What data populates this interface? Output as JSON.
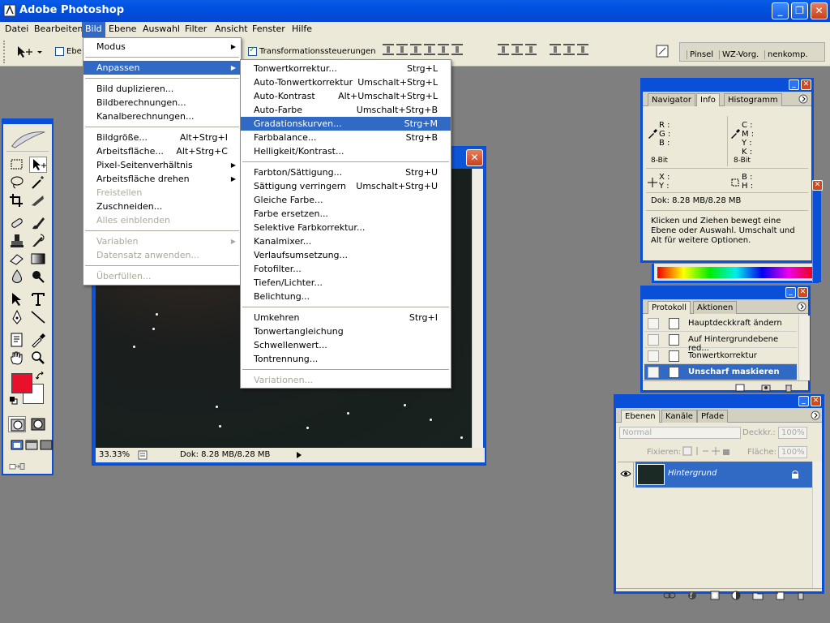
{
  "window": {
    "title": "Adobe Photoshop",
    "min": "_",
    "max": "❐",
    "close": "✕"
  },
  "menubar": [
    "Datei",
    "Bearbeiten",
    "Bild",
    "Ebene",
    "Auswahl",
    "Filter",
    "Ansicht",
    "Fenster",
    "Hilfe"
  ],
  "options": {
    "autoselect_label": "Ebe",
    "transform_label": "Transformationssteuerungen"
  },
  "palette_well": [
    "Pinsel",
    "WZ-Vorg.",
    "nenkomp."
  ],
  "bild_menu": [
    {
      "label": "Modus",
      "arrow": true
    },
    {
      "sep": true
    },
    {
      "label": "Anpassen",
      "arrow": true,
      "hl": true
    },
    {
      "sep": true
    },
    {
      "label": "Bild duplizieren..."
    },
    {
      "label": "Bildberechnungen..."
    },
    {
      "label": "Kanalberechnungen..."
    },
    {
      "sep": true
    },
    {
      "label": "Bildgröße...",
      "shortcut": "Alt+Strg+I"
    },
    {
      "label": "Arbeitsfläche...",
      "shortcut": "Alt+Strg+C"
    },
    {
      "label": "Pixel-Seitenverhältnis",
      "arrow": true
    },
    {
      "label": "Arbeitsfläche drehen",
      "arrow": true
    },
    {
      "label": "Freistellen",
      "disabled": true
    },
    {
      "label": "Zuschneiden..."
    },
    {
      "label": "Alles einblenden",
      "disabled": true
    },
    {
      "sep": true
    },
    {
      "label": "Variablen",
      "arrow": true,
      "disabled": true
    },
    {
      "label": "Datensatz anwenden...",
      "disabled": true
    },
    {
      "sep": true
    },
    {
      "label": "Überfüllen...",
      "disabled": true
    }
  ],
  "anpassen_menu": [
    {
      "label": "Tonwertkorrektur...",
      "shortcut": "Strg+L"
    },
    {
      "label": "Auto-Tonwertkorrektur",
      "shortcut": "Umschalt+Strg+L"
    },
    {
      "label": "Auto-Kontrast",
      "shortcut": "Alt+Umschalt+Strg+L"
    },
    {
      "label": "Auto-Farbe",
      "shortcut": "Umschalt+Strg+B"
    },
    {
      "label": "Gradationskurven...",
      "shortcut": "Strg+M",
      "hl": true
    },
    {
      "label": "Farbbalance...",
      "shortcut": "Strg+B"
    },
    {
      "label": "Helligkeit/Kontrast..."
    },
    {
      "sep": true
    },
    {
      "label": "Farbton/Sättigung...",
      "shortcut": "Strg+U"
    },
    {
      "label": "Sättigung verringern",
      "shortcut": "Umschalt+Strg+U"
    },
    {
      "label": "Gleiche Farbe..."
    },
    {
      "label": "Farbe ersetzen..."
    },
    {
      "label": "Selektive Farbkorrektur..."
    },
    {
      "label": "Kanalmixer..."
    },
    {
      "label": "Verlaufsumsetzung..."
    },
    {
      "label": "Fotofilter..."
    },
    {
      "label": "Tiefen/Lichter..."
    },
    {
      "label": "Belichtung..."
    },
    {
      "sep": true
    },
    {
      "label": "Umkehren",
      "shortcut": "Strg+I"
    },
    {
      "label": "Tonwertangleichung"
    },
    {
      "label": "Schwellenwert..."
    },
    {
      "label": "Tontrennung..."
    },
    {
      "sep": true
    },
    {
      "label": "Variationen...",
      "disabled": true
    }
  ],
  "document": {
    "zoom": "33.33%",
    "doc_info": "Dok: 8.28 MB/8.28 MB"
  },
  "info_panel": {
    "tabs": [
      "Navigator",
      "Info",
      "Histogramm"
    ],
    "rgb": [
      "R :",
      "G :",
      "B :"
    ],
    "cmyk": [
      "C :",
      "M :",
      "Y :",
      "K :"
    ],
    "bitdepth_left": "8-Bit",
    "bitdepth_right": "8-Bit",
    "xy": [
      "X :",
      "Y :"
    ],
    "bh": [
      "B :",
      "H :"
    ],
    "doc": "Dok: 8.28 MB/8.28 MB",
    "hint": "Klicken und Ziehen bewegt eine Ebene oder Auswahl. Umschalt und Alt für weitere Optionen."
  },
  "history_panel": {
    "tabs": [
      "Protokoll",
      "Aktionen"
    ],
    "items": [
      "Hauptdeckkraft ändern",
      "Auf Hintergrundebene red...",
      "Tonwertkorrektur",
      "Unscharf maskieren"
    ]
  },
  "layers_panel": {
    "tabs": [
      "Ebenen",
      "Kanäle",
      "Pfade"
    ],
    "blend": "Normal",
    "opacity_label": "Deckkr.:",
    "opacity": "100%",
    "lock_label": "Fixieren:",
    "fill_label": "Fläche:",
    "fill": "100%",
    "layer_name": "Hintergrund"
  }
}
